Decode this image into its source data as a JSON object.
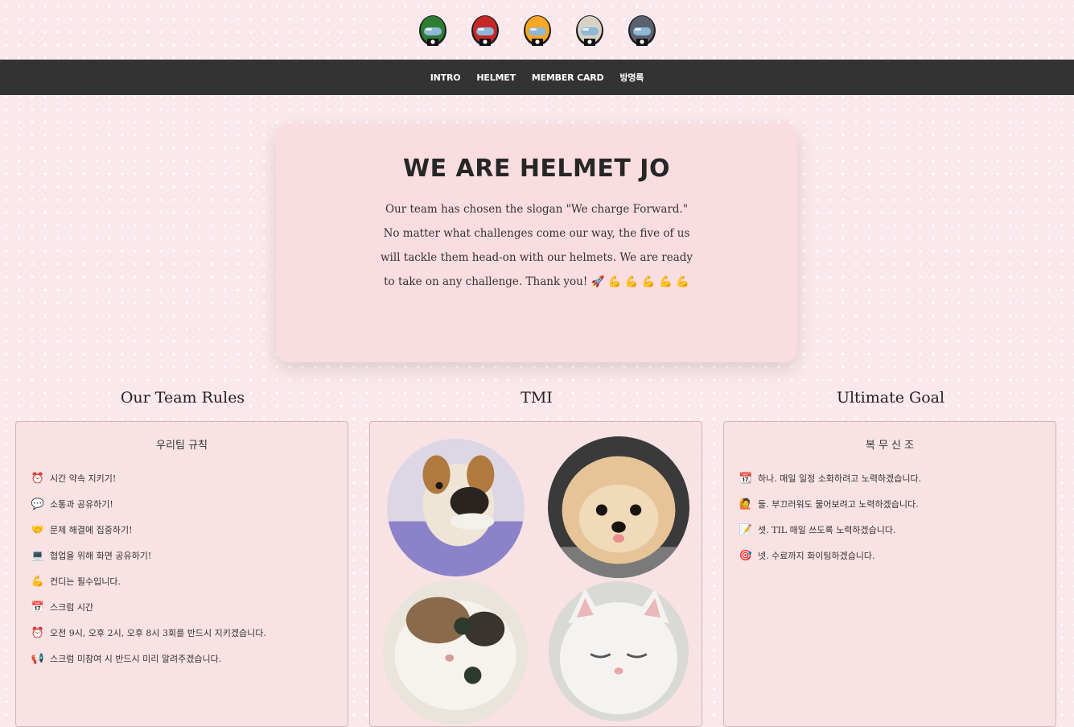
{
  "helmets": [
    {
      "name": "green-helmet-icon",
      "color": "#2e7d32"
    },
    {
      "name": "red-helmet-icon",
      "color": "#c62828"
    },
    {
      "name": "yellow-helmet-icon",
      "color": "#f9a825"
    },
    {
      "name": "white-helmet-icon",
      "color": "#d7d2c3"
    },
    {
      "name": "gray-helmet-icon",
      "color": "#5c6170"
    }
  ],
  "nav": {
    "intro": "INTRO",
    "helmet": "HELMET",
    "member_card": "MEMBER CARD",
    "guestbook": "방명록"
  },
  "hero": {
    "title": "WE ARE HELMET JO",
    "text": "Our team has chosen the slogan \"We charge Forward.\" No matter what challenges come our way, the five of us will tackle them head-on with our helmets. We are ready to take on any challenge. Thank you! 🚀 💪 💪 💪 💪 💪"
  },
  "rules": {
    "section_title": "Our Team Rules",
    "heading": "우리팀 규칙",
    "items": [
      {
        "icon": "alarm-clock-icon",
        "glyph": "⏰",
        "text": "시간 약속 지키기!"
      },
      {
        "icon": "speech-bubble-icon",
        "glyph": "💬",
        "text": "소통과 공유하기!"
      },
      {
        "icon": "handshake-icon",
        "glyph": "🤝",
        "text": "문제 해결에 집중하기!"
      },
      {
        "icon": "computer-icon",
        "glyph": "💻",
        "text": "협업을 위해 화면 공유하기!"
      },
      {
        "icon": "flexed-biceps-icon",
        "glyph": "💪",
        "text": "컨디는 필수입니다."
      },
      {
        "icon": "calendar-icon",
        "glyph": "📅",
        "text": "스크럼 시간"
      },
      {
        "icon": "alarm-clock-icon",
        "glyph": "⏰",
        "text": "오전 9시, 오후 2시, 오후 8시 3회를 반드시 지키겠습니다."
      },
      {
        "icon": "megaphone-icon",
        "glyph": "📢",
        "text": "스크럼 미참여 시 반드시 미리 알려주겠습니다."
      }
    ]
  },
  "tmi": {
    "section_title": "TMI",
    "photos": [
      {
        "name": "dog-photo-1"
      },
      {
        "name": "dog-photo-2"
      },
      {
        "name": "cat-photo-1"
      },
      {
        "name": "cat-photo-2"
      }
    ]
  },
  "goal": {
    "section_title": "Ultimate Goal",
    "heading": "복 무 신 조",
    "items": [
      {
        "icon": "calendar-icon",
        "glyph": "📆",
        "text": "하나. 매일 일정 소화하려고 노력하겠습니다."
      },
      {
        "icon": "raising-hand-icon",
        "glyph": "🙋",
        "text": "둘. 부끄러워도 물어보려고 노력하겠습니다."
      },
      {
        "icon": "memo-icon",
        "glyph": "📝",
        "text": "셋. TIL 매일 쓰도록 노력하겠습니다."
      },
      {
        "icon": "target-icon",
        "glyph": "🎯",
        "text": "넷. 수료까지 화이팅하겠습니다."
      }
    ]
  }
}
